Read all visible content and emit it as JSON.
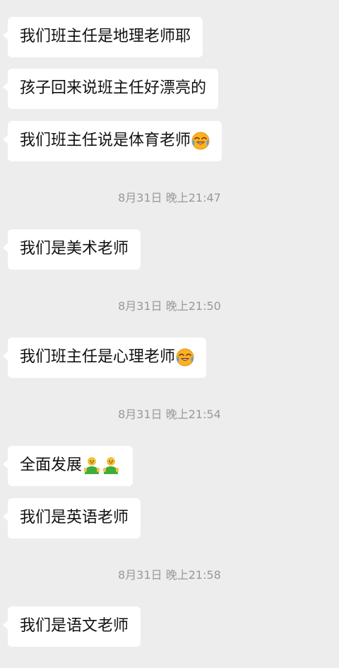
{
  "messages": [
    {
      "text": "我们班主任是地理老师耶"
    },
    {
      "text": "孩子回来说班主任好漂亮的"
    },
    {
      "text": "我们班主任说是体育老师",
      "emoji": "laugh-cry-emoji"
    },
    {
      "text": "我们是美术老师"
    },
    {
      "text": "我们班主任是心理老师",
      "emoji": "laugh-cry-emoji"
    },
    {
      "text": "全面发展",
      "emoji": "green-people-emoji"
    },
    {
      "text": "我们是英语老师"
    },
    {
      "text": "我们是语文老师"
    }
  ],
  "timestamps": [
    "8月31日 晚上21:47",
    "8月31日 晚上21:50",
    "8月31日 晚上21:54",
    "8月31日 晚上21:58"
  ],
  "colors": {
    "background": "#ededed",
    "bubble": "#ffffff",
    "text": "#111111",
    "timestamp": "#999999"
  }
}
